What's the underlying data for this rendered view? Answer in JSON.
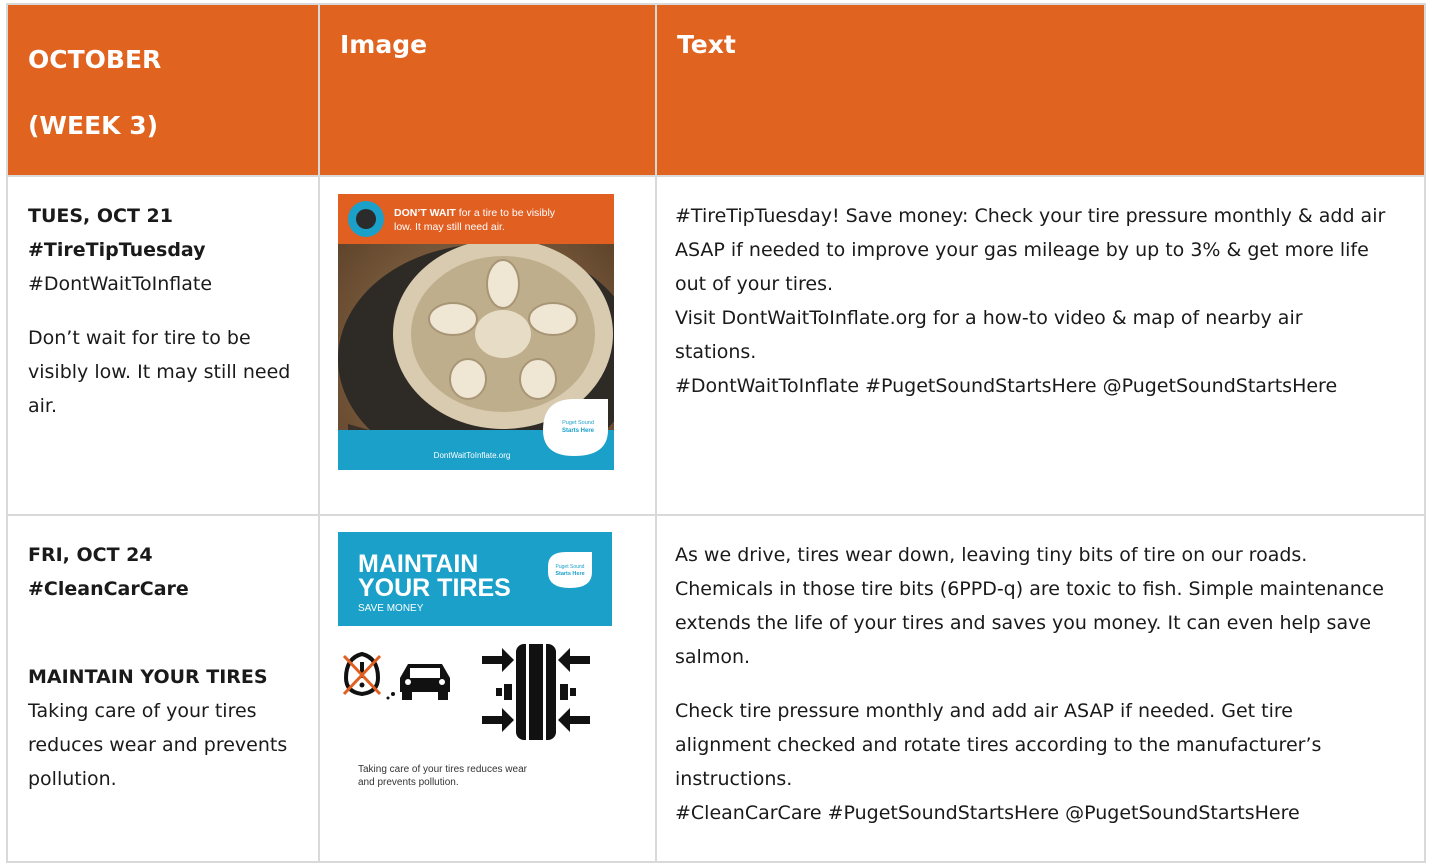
{
  "header": {
    "col1_line1": "OCTOBER",
    "col1_line2": "(WEEK 3)",
    "col2": "Image",
    "col3": "Text"
  },
  "colors": {
    "header_bg": "#e06420",
    "graphic_orange": "#e25f22",
    "graphic_blue": "#1aa0c9"
  },
  "rows": [
    {
      "day": "TUES, OCT 21",
      "tag_bold": "#TireTipTuesday",
      "tag_plain": "#DontWaitToInflate",
      "description": "Don’t wait for tire to be visibly low. It may still need air.",
      "image": {
        "headline_bold": "DON’T WAIT",
        "headline_rest": " for a tire to be visibly",
        "headline_line2": "low. It may still need air.",
        "logo_line1": "Puget Sound",
        "logo_line2": "Starts Here",
        "footer_url": "DontWaitToInflate.org"
      },
      "text": {
        "line1": "#TireTipTuesday! Save money: Check your tire pressure monthly & add air",
        "line2": "ASAP if needed to improve your gas mileage by up to 3% & get more life",
        "line3": "out of your tires.",
        "line4": "Visit DontWaitToInflate.org for a how-to video & map of nearby air",
        "line5": "stations.",
        "line6": "#DontWaitToInflate #PugetSoundStartsHere @PugetSoundStartsHere"
      }
    },
    {
      "day": "FRI, OCT 24",
      "tag_bold": "#CleanCarCare",
      "heading": "MAINTAIN YOUR TIRES",
      "description": "Taking care of your tires reduces wear and prevents pollution.",
      "image": {
        "title_line1": "MAINTAIN",
        "title_line2": "YOUR TIRES",
        "subtitle": "SAVE MONEY",
        "logo_line1": "Puget Sound",
        "logo_line2": "Starts Here",
        "caption_line1": "Taking care of your tires reduces wear",
        "caption_line2": "and prevents pollution."
      },
      "text": {
        "line1": "As we drive, tires wear down, leaving tiny bits of tire on our roads.",
        "line2": "Chemicals in those tire bits (6PPD-q) are toxic to fish. Simple maintenance",
        "line3": "extends the life of your tires and saves you money. It can even help save",
        "line4": "salmon.",
        "line5": "Check tire pressure monthly and add air ASAP if needed. Get tire",
        "line6": "alignment checked and rotate tires according to the manufacturer’s",
        "line7": "instructions.",
        "line8": "#CleanCarCare #PugetSoundStartsHere @PugetSoundStartsHere"
      }
    }
  ]
}
